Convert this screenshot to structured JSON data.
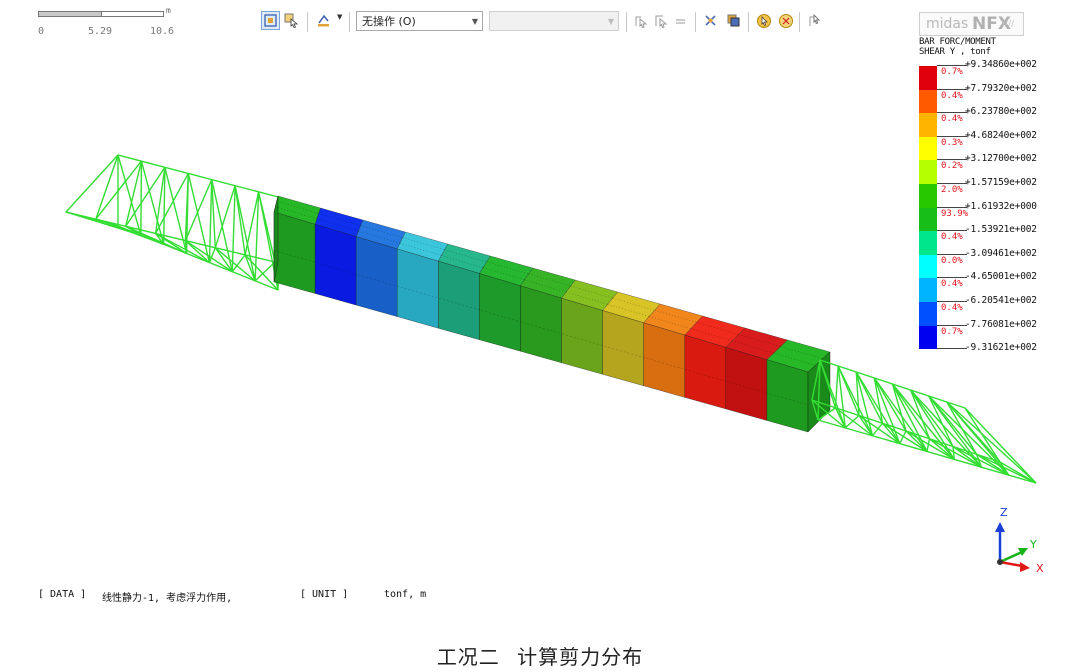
{
  "scale_bar": {
    "ticks": [
      "0",
      "5.29",
      "10.6"
    ],
    "unit": "m"
  },
  "toolbar": {
    "operation_select": {
      "value": "无操作 (O)"
    },
    "secondary_select": {
      "value": ""
    }
  },
  "logo": {
    "brand": "midas",
    "product": "NFX"
  },
  "legend": {
    "title_line1": "BAR FORC/MOMENT",
    "title_line2": "SHEAR Y , tonf",
    "values": [
      "+9.34860e+002",
      "+7.79320e+002",
      "+6.23780e+002",
      "+4.68240e+002",
      "+3.12700e+002",
      "+1.57159e+002",
      "+1.61932e+000",
      "-1.53921e+002",
      "-3.09461e+002",
      "-4.65001e+002",
      "-6.20541e+002",
      "-7.76081e+002",
      "-9.31621e+002"
    ],
    "percents": [
      "0.7%",
      "0.4%",
      "0.4%",
      "0.3%",
      "0.2%",
      "2.0%",
      "93.9%",
      "0.4%",
      "0.0%",
      "0.4%",
      "0.4%",
      "0.7%"
    ],
    "colors": [
      "#e0000c",
      "#ff5a00",
      "#ffb400",
      "#ffff00",
      "#b4ff00",
      "#28c800",
      "#18be18",
      "#00e68c",
      "#00ffff",
      "#00b4ff",
      "#0050ff",
      "#0000f0"
    ]
  },
  "axes": {
    "z": "Z",
    "y": "Y",
    "x": "X"
  },
  "info": {
    "data_tag": "[ DATA ]",
    "data_value": "线性静力-1,  考虑浮力作用,",
    "unit_tag": "[ UNIT ]",
    "unit_value": "tonf,  m"
  },
  "caption": "工况二 计算剪力分布"
}
